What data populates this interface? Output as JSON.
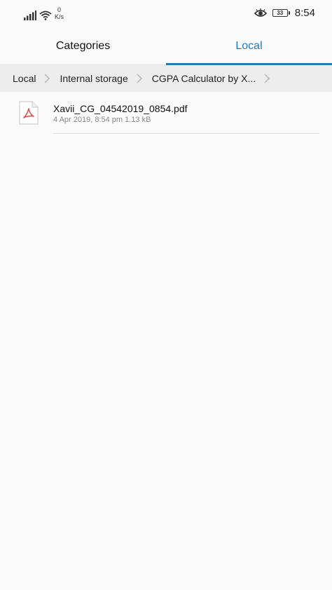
{
  "status_bar": {
    "net_speed_value": "0",
    "net_speed_unit": "K/s",
    "battery_level": "33",
    "time": "8:54"
  },
  "tabs": [
    {
      "label": "Categories",
      "active": false
    },
    {
      "label": "Local",
      "active": true
    }
  ],
  "breadcrumb": [
    "Local",
    "Internal storage",
    "CGPA Calculator by X..."
  ],
  "files": [
    {
      "name": "Xavii_CG_04542019_0854.pdf",
      "date": "4 Apr 2019, 8:54 pm",
      "size": "1.13 kB",
      "icon": "pdf-file-icon"
    }
  ],
  "colors": {
    "accent": "#1f7ab8",
    "pdf_red": "#d9534f"
  }
}
